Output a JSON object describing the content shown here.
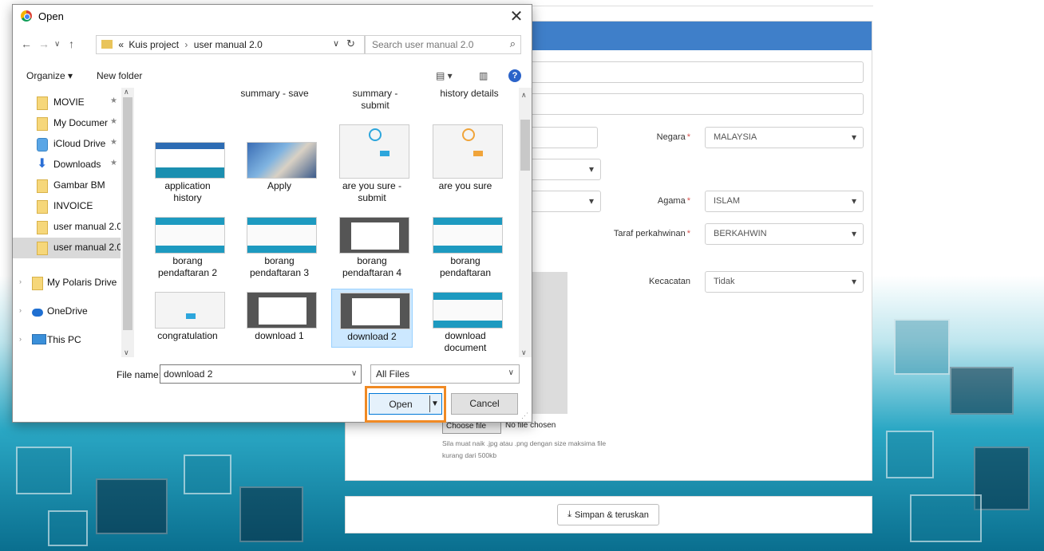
{
  "dialog": {
    "title": "Open",
    "path": {
      "prefix": "«",
      "parent": "Kuis project",
      "separator": "›",
      "current": "user manual 2.0"
    },
    "search_placeholder": "Search user manual 2.0",
    "organize_label": "Organize ▾",
    "new_folder_label": "New folder",
    "nav_items": [
      {
        "label": "MOVIE",
        "pinned": true
      },
      {
        "label": "My Documer",
        "pinned": true
      },
      {
        "label": "iCloud Drive",
        "pinned": true
      },
      {
        "label": "Downloads",
        "pinned": true
      },
      {
        "label": "Gambar BM"
      },
      {
        "label": "INVOICE"
      },
      {
        "label": "user manual 2.0"
      },
      {
        "label": "user manual 2.0",
        "selected": true
      },
      {
        "label": "My Polaris Drive"
      },
      {
        "label": "OneDrive"
      },
      {
        "label": "This PC"
      }
    ],
    "top_captions": [
      "summary - save",
      "summary -\nsubmit",
      "history details"
    ],
    "files": [
      {
        "label": "application\nhistory",
        "thumb": "blue"
      },
      {
        "label": "Apply",
        "thumb": "photo"
      },
      {
        "label": "are you sure -\nsubmit",
        "thumb": "modal"
      },
      {
        "label": "are you sure",
        "thumb": "modal-orange"
      },
      {
        "label": "borang\npendaftaran 2",
        "thumb": "cyan"
      },
      {
        "label": "borang\npendaftaran 3",
        "thumb": "cyan"
      },
      {
        "label": "borang\npendaftaran 4",
        "thumb": "dark"
      },
      {
        "label": "borang\npendaftaran",
        "thumb": "cyan"
      },
      {
        "label": "congratulation",
        "thumb": "modal"
      },
      {
        "label": "download 1",
        "thumb": "dark"
      },
      {
        "label": "download 2",
        "thumb": "dark",
        "selected": true
      },
      {
        "label": "download\ndocument",
        "thumb": "cyan"
      }
    ],
    "file_name_label": "File name:",
    "file_name_value": "download 2",
    "file_type_value": "All Files",
    "open_label": "Open",
    "cancel_label": "Cancel"
  },
  "form": {
    "negara_label": "Negara",
    "negara_value": "MALAYSIA",
    "agama_label": "Agama",
    "agama_value": "ISLAM",
    "taraf_label": "Taraf perkahwinan",
    "taraf_value": "BERKAHWIN",
    "kecacatan_label": "Kecacatan",
    "kecacatan_value": "Tidak",
    "choose_file_label": "Choose file",
    "no_file_label": "No file chosen",
    "upload_hint": "Sila muat naik .jpg atau .png dengan size maksima file kurang dari 500kb",
    "submit_label": "Simpan & teruskan"
  },
  "colors": {
    "form_header": "#3f7fc9",
    "highlight": "#f08a24",
    "selection": "#cce8ff"
  }
}
